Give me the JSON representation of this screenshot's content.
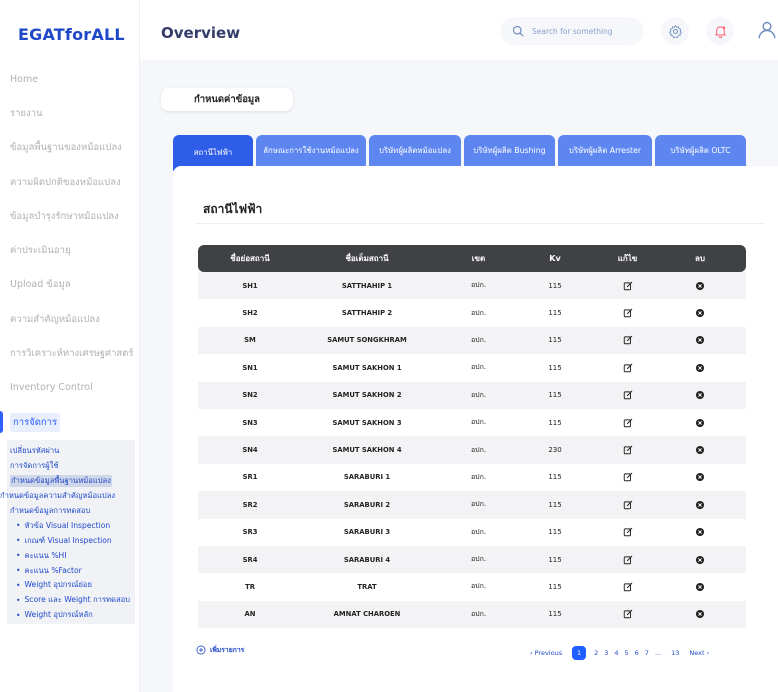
{
  "logo": "EGATforALL",
  "header": {
    "title": "Overview",
    "search_placeholder": "Search for something"
  },
  "sidebar": {
    "items": [
      {
        "label": "Home"
      },
      {
        "label": "รายงาน"
      },
      {
        "label": "ข้อมูลพื้นฐานของหม้อแปลง"
      },
      {
        "label": "ความผิดปกติของหม้อแปลง"
      },
      {
        "label": "ข้อมูลบำรุงรักษาหม้อแปลง"
      },
      {
        "label": "ค่าประเมินอายุ"
      },
      {
        "label": "Upload ข้อมูล"
      },
      {
        "label": "ความสำคัญหม้อแปลง"
      },
      {
        "label": "การวิเคราะห์ทางเศรษฐศาสตร์"
      },
      {
        "label": "Inventory Control"
      },
      {
        "label": "การจัดการ"
      }
    ],
    "subitems": [
      {
        "label": "เปลี่ยนรหัสผ่าน"
      },
      {
        "label": "การจัดการผู้ใช้"
      },
      {
        "label": "กำหนดข้อมูลพื้นฐานหม้อแปลง"
      },
      {
        "label": "กำหนดข้อมูลความสำคัญหม้อแปลง"
      },
      {
        "label": "กำหนดข้อมูลการทดสอบ"
      },
      {
        "label": "หัวข้อ Visual Inspection"
      },
      {
        "label": "เกณฑ์ Visual Inspection"
      },
      {
        "label": "คะแนน %HI"
      },
      {
        "label": "คะแนน %Factor"
      },
      {
        "label": "Weight อุปกรณ์ย่อย"
      },
      {
        "label": "Score และ Weight การทดสอบ"
      },
      {
        "label": "Weight อุปกรณ์หลัก"
      }
    ]
  },
  "main": {
    "section_pill": "กำหนดค่าข้อมูล",
    "tabs": [
      {
        "label": "สถานีไฟฟ้า"
      },
      {
        "label": "ลักษณะการใช้งานหม้อแปลง"
      },
      {
        "label": "บริษัทผู้ผลิตหม้อแปลง"
      },
      {
        "label": "บริษัทผู้ผลิต Bushing"
      },
      {
        "label": "บริษัทผู้ผลิต Arrester"
      },
      {
        "label": "บริษัทผู้ผลิต OLTC"
      }
    ],
    "panel_title": "สถานีไฟฟ้า",
    "table": {
      "headers": [
        "ชื่อย่อสถานี",
        "ชื่อเต็มสถานี",
        "เขต",
        "Kv",
        "แก้ไข",
        "ลบ"
      ],
      "rows": [
        {
          "code": "SH1",
          "name": "SATTHAHIP 1",
          "zone": "อปก.",
          "kv": "115"
        },
        {
          "code": "SH2",
          "name": "SATTHAHIP 2",
          "zone": "อปก.",
          "kv": "115"
        },
        {
          "code": "SM",
          "name": "SAMUT SONGKHRAM",
          "zone": "อปก.",
          "kv": "115"
        },
        {
          "code": "SN1",
          "name": "SAMUT SAKHON 1",
          "zone": "อปก.",
          "kv": "115"
        },
        {
          "code": "SN2",
          "name": "SAMUT SAKHON 2",
          "zone": "อปก.",
          "kv": "115"
        },
        {
          "code": "SN3",
          "name": "SAMUT SAKHON 3",
          "zone": "อปก.",
          "kv": "115"
        },
        {
          "code": "SN4",
          "name": "SAMUT SAKHON 4",
          "zone": "อปก.",
          "kv": "230"
        },
        {
          "code": "SR1",
          "name": "SARABURI 1",
          "zone": "อปก.",
          "kv": "115"
        },
        {
          "code": "SR2",
          "name": "SARABURI 2",
          "zone": "อปก.",
          "kv": "115"
        },
        {
          "code": "SR3",
          "name": "SARABURI 3",
          "zone": "อปก.",
          "kv": "115"
        },
        {
          "code": "SR4",
          "name": "SARABURI 4",
          "zone": "อปก.",
          "kv": "115"
        },
        {
          "code": "TR",
          "name": "TRAT",
          "zone": "อปก.",
          "kv": "115"
        },
        {
          "code": "AN",
          "name": "AMNAT CHAROEN",
          "zone": "อปก.",
          "kv": "115"
        }
      ]
    },
    "add_label": "เพิ่มรายการ",
    "pagination": {
      "prev": "Previous",
      "current": "1",
      "pages": [
        "2",
        "3",
        "4",
        "5",
        "6",
        "7",
        "...",
        "13"
      ],
      "next": "Next"
    }
  },
  "colors": {
    "brand": "#1f48c8",
    "accent": "#2d60ff",
    "tab": "#5d86f0",
    "tab_active": "#2e5de8",
    "table_header": "#3f4145",
    "alert": "#fe5c73"
  }
}
